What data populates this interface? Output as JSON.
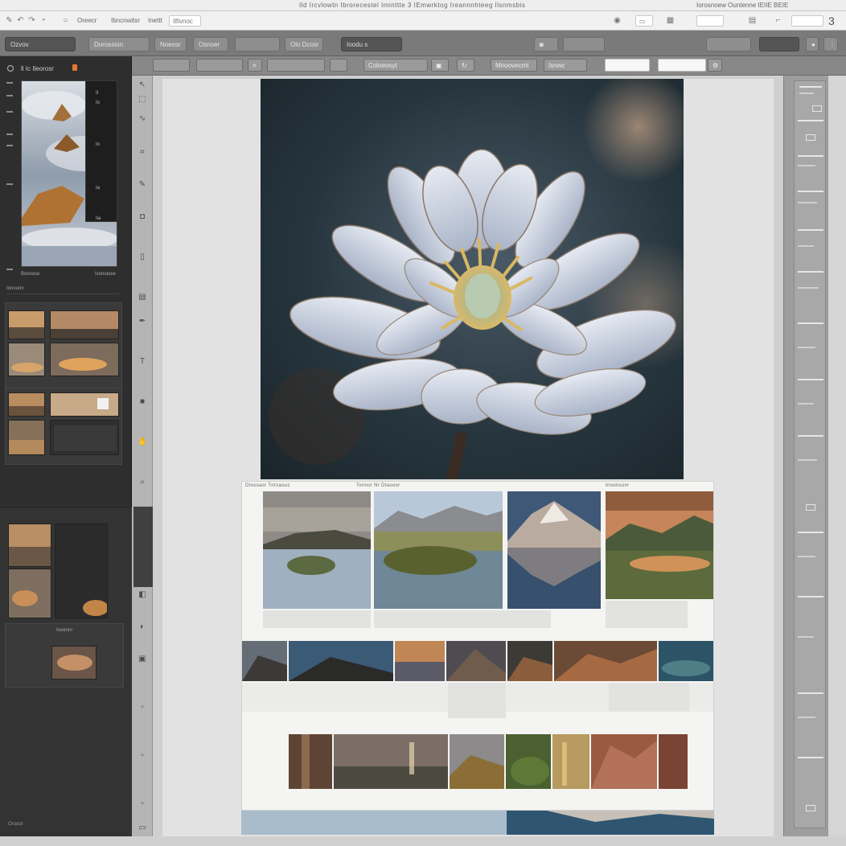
{
  "menu": {
    "title": "Ild Ircvlowtn     Ibrorecestel  Iminttte 3  IEmwrktog  Ireannnhteeg  Ilsnmsbis",
    "right_title": "Iorosnoew  Ountenne  IEIIE BEIE",
    "items": [
      "Oreecr",
      "Ibncnwitsr",
      "Inettt",
      "Ilfivnoc"
    ],
    "corner_number": "3"
  },
  "toolbar": {
    "items": [
      "Ozvov",
      "Dorossion",
      "Noeosr",
      "Osnoer",
      "Olo Dcosr",
      "Ioodu  s"
    ]
  },
  "options": {
    "items": [
      "Coloeosyt",
      "Mnoovecmt",
      "Isnwc"
    ]
  },
  "left_panel": {
    "header_label": "ll Ic  Ileorosr",
    "overlay_lines": [
      "II",
      "Io",
      "Io",
      "Ia",
      "Iia"
    ],
    "info_left": "Bosnose",
    "info_right": "Isonoeuw",
    "section_labels": [
      "Ionounn",
      "Iooennr"
    ],
    "bottom_label": "Oruoor"
  },
  "sheet": {
    "labels": [
      "Dtoosasr Tnrsaouz",
      "Tonnor Nr Dtaooor",
      "Inoonsonr"
    ]
  },
  "colors": {
    "accent_orange": "#e5772e",
    "panel_dark": "#2e2e2e",
    "toolbar_gray": "#7a7a7a"
  }
}
